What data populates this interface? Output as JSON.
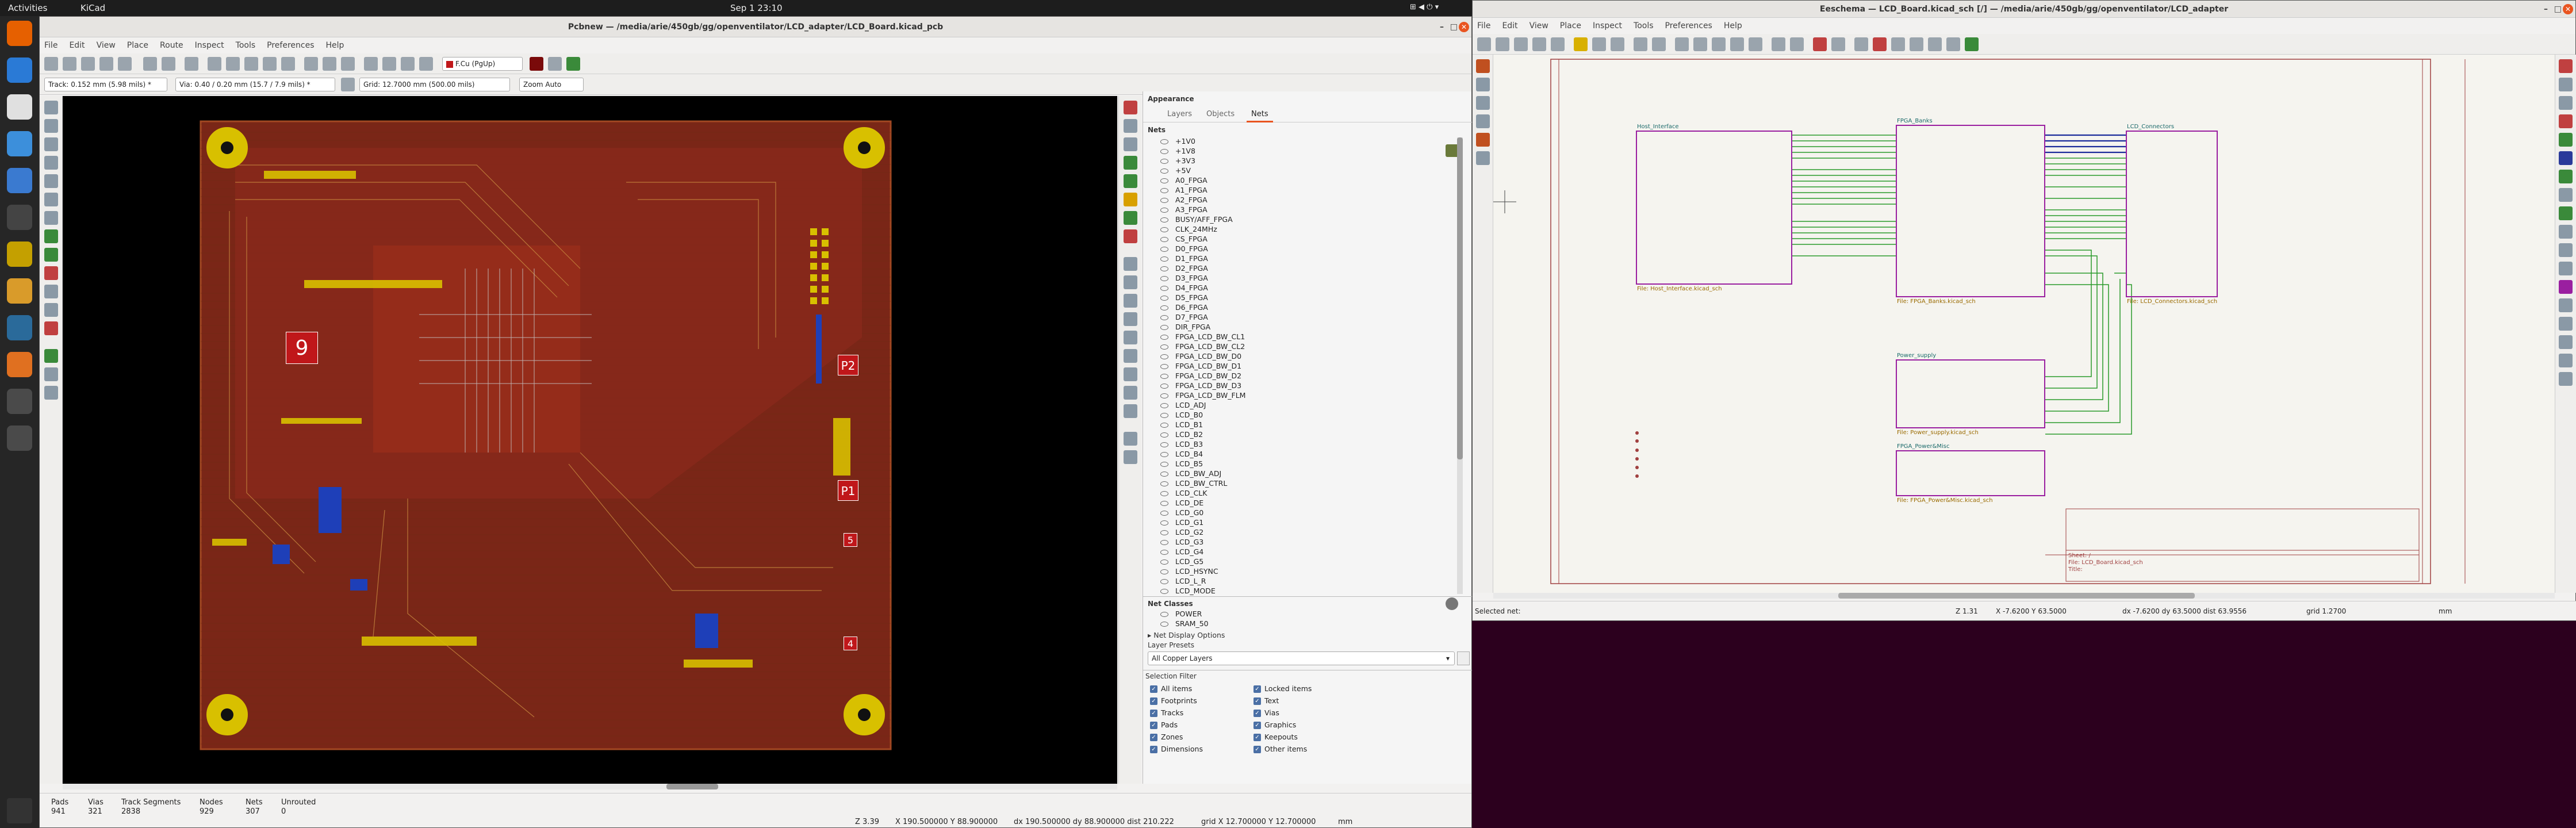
{
  "topbar": {
    "activities": "Activities",
    "app": "KiCad",
    "clock": "Sep 1  23:10"
  },
  "pcb": {
    "title": "Pcbnew — /media/arie/450gb/gg/openventilator/LCD_adapter/LCD_Board.kicad_pcb",
    "menu": [
      "File",
      "Edit",
      "View",
      "Place",
      "Route",
      "Inspect",
      "Tools",
      "Preferences",
      "Help"
    ],
    "layer": "F.Cu (PgUp)",
    "track": "Track: 0.152 mm (5.98 mils) *",
    "via": "Via: 0.40 / 0.20 mm (15.7 / 7.9 mils) *",
    "grid": "Grid: 12.7000 mm (500.00 mils)",
    "zoom": "Zoom Auto",
    "refs": [
      "9",
      "P2",
      "P1",
      "5",
      "4"
    ],
    "appearance": {
      "title": "Appearance",
      "tabs": [
        "Layers",
        "Objects",
        "Nets"
      ],
      "active_tab": "Nets",
      "nets_label": "Nets",
      "nets": [
        "+1V0",
        "+1V8",
        "+3V3",
        "+5V",
        "A0_FPGA",
        "A1_FPGA",
        "A2_FPGA",
        "A3_FPGA",
        "BUSY/AFF_FPGA",
        "CLK_24MHz",
        "CS_FPGA",
        "D0_FPGA",
        "D1_FPGA",
        "D2_FPGA",
        "D3_FPGA",
        "D4_FPGA",
        "D5_FPGA",
        "D6_FPGA",
        "D7_FPGA",
        "DIR_FPGA",
        "FPGA_LCD_BW_CL1",
        "FPGA_LCD_BW_CL2",
        "FPGA_LCD_BW_D0",
        "FPGA_LCD_BW_D1",
        "FPGA_LCD_BW_D2",
        "FPGA_LCD_BW_D3",
        "FPGA_LCD_BW_FLM",
        "LCD_ADJ",
        "LCD_B0",
        "LCD_B1",
        "LCD_B2",
        "LCD_B3",
        "LCD_B4",
        "LCD_B5",
        "LCD_BW_ADJ",
        "LCD_BW_CTRL",
        "LCD_CLK",
        "LCD_DE",
        "LCD_G0",
        "LCD_G1",
        "LCD_G2",
        "LCD_G3",
        "LCD_G4",
        "LCD_G5",
        "LCD_HSYNC",
        "LCD_L_R",
        "LCD_MODE"
      ],
      "net_classes_label": "Net Classes",
      "net_classes": [
        "POWER",
        "SRAM_50"
      ],
      "net_display_options": "Net Display Options",
      "layer_presets_label": "Layer Presets",
      "layer_preset": "All Copper Layers"
    },
    "selection_filter": {
      "title": "Selection Filter",
      "left": [
        "All items",
        "Footprints",
        "Tracks",
        "Pads",
        "Zones",
        "Dimensions"
      ],
      "right": [
        "Locked items",
        "Text",
        "Vias",
        "Graphics",
        "Keepouts",
        "Other items"
      ]
    },
    "status": {
      "headers": [
        "Pads",
        "Vias",
        "Track Segments",
        "Nodes",
        "Nets",
        "Unrouted"
      ],
      "values": [
        "941",
        "321",
        "2838",
        "929",
        "307",
        "0"
      ],
      "zoom": "Z 3.39",
      "coords": "X 190.500000  Y 88.900000",
      "delta": "dx 190.500000  dy 88.900000  dist 210.222",
      "grid": "grid X 12.700000  Y 12.700000",
      "units": "mm"
    }
  },
  "sch": {
    "title": "Eeschema — LCD_Board.kicad_sch [/] — /media/arie/450gb/gg/openventilator/LCD_adapter",
    "menu": [
      "File",
      "Edit",
      "View",
      "Place",
      "Inspect",
      "Tools",
      "Preferences",
      "Help"
    ],
    "sheets": [
      {
        "name": "Host_Interface",
        "file": "File: Host_Interface.kicad_sch"
      },
      {
        "name": "FPGA_Banks",
        "file": "File: FPGA_Banks.kicad_sch"
      },
      {
        "name": "LCD_Connectors",
        "file": "File: LCD_Connectors.kicad_sch"
      },
      {
        "name": "Power_supply",
        "file": "File: Power_supply.kicad_sch"
      },
      {
        "name": "FPGA_Power&Misc",
        "file": "File: FPGA_Power&Misc.kicad_sch"
      }
    ],
    "title_block": {
      "sheet": "Sheet: /",
      "file": "File: LCD_Board.kicad_sch",
      "title": "Title:"
    },
    "status": {
      "selected": "Selected net:",
      "zoom": "Z 1.31",
      "coords": "X -7.6200  Y 63.5000",
      "delta": "dx -7.6200  dy 63.5000  dist 63.9556",
      "grid": "grid 1.2700",
      "units": "mm"
    }
  },
  "colors": {
    "board": "#8c2a1c",
    "copper": "#c83a1a",
    "pad": "#d8c000",
    "bcu": "#1e3fb8",
    "bg": "#000000",
    "sheet": "#9a1fa0",
    "wire": "#2a9a2a"
  }
}
